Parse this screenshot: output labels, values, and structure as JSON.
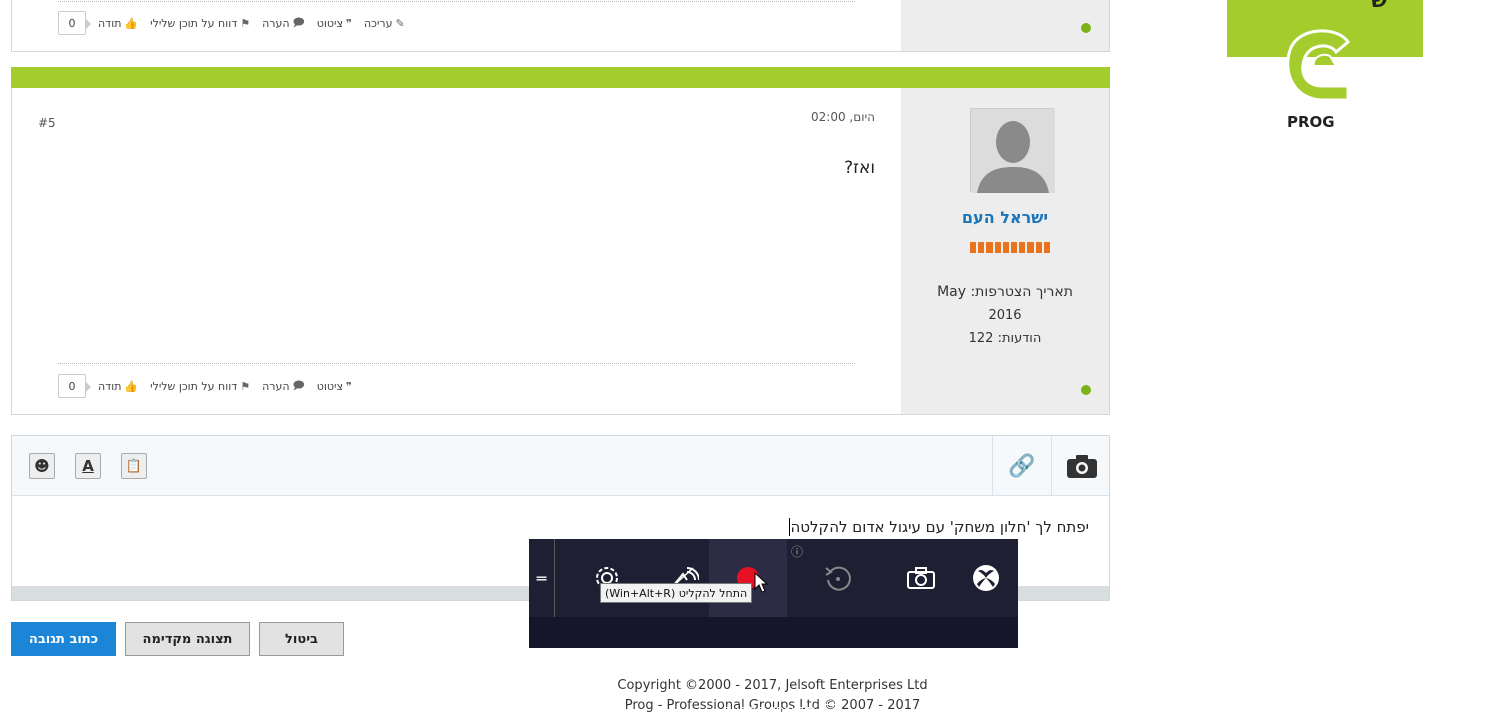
{
  "logo": {
    "text": "PROG",
    "top_fragment": "ש"
  },
  "post_prev": {
    "actions": {
      "edit": "עריכה",
      "quote": "ציטוט",
      "comment": "הערה",
      "report": "דווח על תוכן שלילי",
      "thanks": "תודה",
      "thanks_count": "0"
    }
  },
  "post": {
    "number": "#5",
    "date": "היום, 02:00",
    "content": "ואז?",
    "username": "ישראל העם",
    "join_date": "תאריך הצטרפות: May",
    "join_year": "2016",
    "posts": "הודעות: 122",
    "actions": {
      "quote": "ציטוט",
      "comment": "הערה",
      "report": "דווח על תוכן שלילי",
      "thanks": "תודה",
      "thanks_count": "0"
    }
  },
  "editor": {
    "text": "יפתח לך 'חלון משחק' עם עיגול אדום להקלטה"
  },
  "buttons": {
    "submit": "כתוב תגובה",
    "preview": "תצוגה מקדימה",
    "cancel": "ביטול"
  },
  "footer": {
    "line1": "Copyright ©2000 - 2017, Jelsoft Enterprises Ltd",
    "line2": "Prog - Professional Groups Ltd © 2007 - 2017"
  },
  "gamebar": {
    "tooltip": "התחל להקליט (Win+Alt+R)",
    "mic_label": "מיקרופון הקלטה",
    "handle": "═",
    "info": "ⓘ"
  },
  "colors": {
    "accent_green": "#a4cc2c",
    "primary_blue": "#1b85d8",
    "online": "#7ab317",
    "rank_orange": "#e8731c"
  }
}
